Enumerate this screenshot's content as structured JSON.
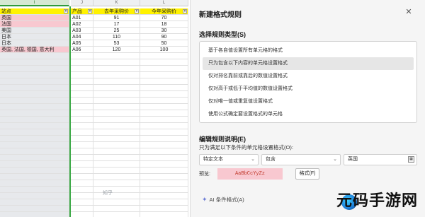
{
  "sheet": {
    "columns": [
      {
        "letter": "I",
        "active": true
      },
      {
        "letter": "J",
        "active": false
      },
      {
        "letter": "K",
        "active": false
      },
      {
        "letter": "L",
        "active": false
      }
    ],
    "headers": [
      "站点",
      "产品",
      "去年采购价",
      "今年采购价"
    ],
    "rows": [
      {
        "site": "英国",
        "product": "A01",
        "last": "91",
        "this": "70",
        "highlight": true
      },
      {
        "site": "法国",
        "product": "A02",
        "last": "17",
        "this": "18",
        "highlight": true
      },
      {
        "site": "美国",
        "product": "A03",
        "last": "25",
        "this": "30",
        "highlight": false
      },
      {
        "site": "日本",
        "product": "A04",
        "last": "110",
        "this": "90",
        "highlight": false
      },
      {
        "site": "日本",
        "product": "A05",
        "last": "53",
        "this": "50",
        "highlight": false
      },
      {
        "site": "英国, 法国, 德国, 意大利",
        "product": "A06",
        "last": "120",
        "this": "100",
        "highlight": true
      }
    ]
  },
  "dialog": {
    "title": "新建格式规则",
    "close_glyph": "✕",
    "rule_type_label": "选择规则类型(S)",
    "rule_types": [
      "基于各自值设置所有单元格的格式",
      "只为包含以下内容的单元格设置格式",
      "仅对排名靠前或靠后的数值设置格式",
      "仅对高于或低于平均值的数值设置格式",
      "仅对唯一值或重复值设置格式",
      "使用公式确定要设置格式的单元格"
    ],
    "selected_rule_index": 1,
    "edit_label": "编辑规则说明(E)",
    "desc_text": "只为满足以下条件的单元格设置格式(O):",
    "condition_type": "特定文本",
    "condition_op": "包含",
    "condition_value": "英国",
    "preview_label": "预览:",
    "preview_sample": "AaBbCcYyZz",
    "format_button": "格式(F)",
    "ai_button": "AI 条件格式(A)"
  },
  "watermark": {
    "brand": "元码手游网",
    "zh_hint": "知乎"
  },
  "colors": {
    "header_yellow": "#fff200",
    "highlight_pink": "#f8c8d0",
    "preview_text": "#c0392b",
    "accent_green": "#3aa845"
  }
}
